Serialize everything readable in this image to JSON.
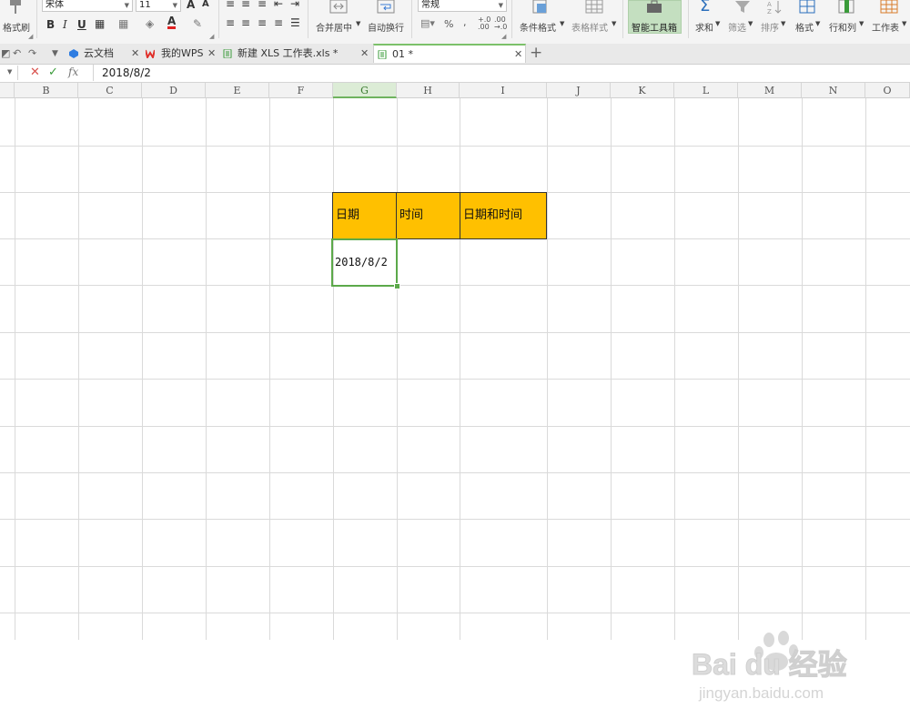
{
  "ribbon": {
    "format_painter": "格式刷",
    "font_name": "宋体",
    "font_size": "11",
    "bold": "B",
    "italic": "I",
    "underline": "U",
    "merge_center": "合并居中",
    "wrap_text": "自动换行",
    "number_format": "常规",
    "percent": "%",
    "conditional_format": "条件格式",
    "table_style": "表格样式",
    "smart_toolbox": "智能工具箱",
    "sum": "求和",
    "filter": "筛选",
    "sort": "排序",
    "format": "格式",
    "row_col": "行和列",
    "worksheet": "工作表"
  },
  "tabs": [
    {
      "label": "云文档"
    },
    {
      "label": "我的WPS"
    },
    {
      "label": "新建 XLS 工作表.xls *"
    },
    {
      "label": "01 *"
    }
  ],
  "formula_bar": {
    "value": "2018/8/2"
  },
  "columns": [
    "B",
    "C",
    "D",
    "E",
    "F",
    "G",
    "H",
    "I",
    "J",
    "K",
    "L",
    "M",
    "N",
    "O"
  ],
  "selected_column": "G",
  "sheet": {
    "headers": [
      "日期",
      "时间",
      "日期和时间"
    ],
    "values": [
      "2018/8/2",
      "",
      ""
    ]
  },
  "watermark": {
    "brand": "Bai du 经验",
    "url": "jingyan.baidu.com"
  },
  "colors": {
    "header_fill": "#ffc000",
    "selection": "#5ca94a",
    "active_tab_accent": "#7cc16a"
  }
}
